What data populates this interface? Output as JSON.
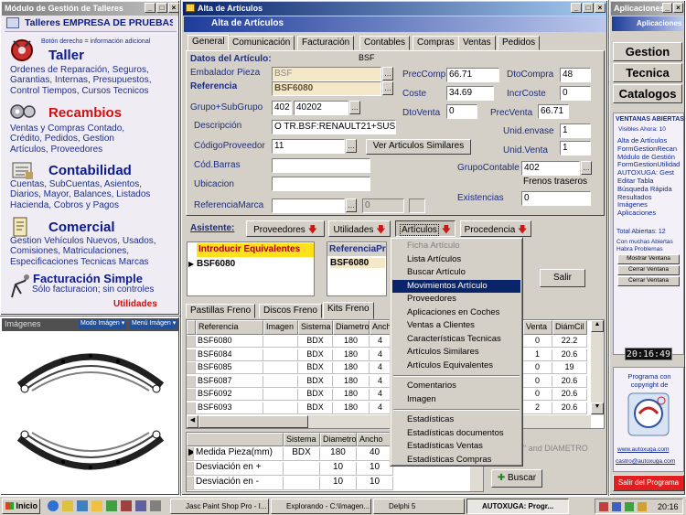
{
  "left_window": {
    "title": "Módulo de Gestión de Talleres",
    "company": "Talleres EMPRESA DE PRUEBAS",
    "hint": "Botón derecho = información adicional",
    "sections": [
      {
        "title": "Taller",
        "lines": [
          "Ordenes de Reparación, Seguros,",
          "Garantias, Internas, Presupuestos,",
          "Control Tiempos, Cursos Tecnicos"
        ]
      },
      {
        "title": "Recambios",
        "lines": [
          "Ventas y Compras Contado,",
          "Crédito, Pedidos,  Gestion",
          "Artículos, Proveedores"
        ]
      },
      {
        "title": "Contabilidad",
        "lines": [
          "Cuentas, SubCuentas, Asientos,",
          "Diarios, Mayor, Balances, Listados",
          "Hacienda, Cobros y Pagos"
        ]
      },
      {
        "title": "Comercial",
        "lines": [
          "Gestion Vehículos Nuevos, Usados,",
          "Comisiones, Matriculaciones,",
          "Especificaciones Tecnicas Marcas"
        ]
      },
      {
        "title": "Facturación Simple",
        "lines": [
          "Sólo facturacion; sin controles"
        ]
      }
    ],
    "utilidades": "Utilidades",
    "colors": {
      "title": "#0b1a8e",
      "recambios": "#d21010",
      "utilidades": "#d21010"
    }
  },
  "images_panel": {
    "title": "Imágenes",
    "mode_label": "Modo Imágen",
    "menu_label": "Menú Imágen"
  },
  "main_window": {
    "title": "Alta de Artículos",
    "header": "Alta de Artículos",
    "tabs": [
      "General",
      "Comunicación",
      "Facturación",
      "Contables",
      "Compras",
      "Ventas",
      "Pedidos"
    ],
    "fields": {
      "datos_label": "Datos del Artículo:",
      "datos_value": "BSF",
      "embalador_label": "Embalador Pieza",
      "embalador_value": "BSF",
      "referencia_label": "Referencia",
      "referencia_value": "BSF6080",
      "grupo_label": "Grupo+SubGrupo",
      "grupo_value": "402",
      "subgrupo_value": "40202",
      "descripcion_label": "Descripción",
      "descripcion_value": "O TR.BSF:RENAULT21+SUS",
      "codprov_label": "CódigoProveedor",
      "codprov_value": "11",
      "similares_button": "Ver Articulos Similares",
      "codbarras_label": "Cód.Barras",
      "ubicacion_label": "Ubicacion",
      "refmarca_label": "ReferenciaMarca",
      "refmarca_num": "0",
      "preccomp_label": "PrecComp",
      "preccomp_value": "66.71",
      "dtocompra_label": "DtoCompra",
      "dtocompra_value": "48",
      "coste_label": "Coste",
      "coste_value": "34.69",
      "incrcoste_label": "IncrCoste",
      "incrcoste_value": "0",
      "dtoventa_label": "DtoVenta",
      "dtoventa_value": "0",
      "precventa_label": "PrecVenta",
      "precventa_value": "66.71",
      "unienvase_label": "Unid.envase",
      "unienvase_value": "1",
      "univenta_label": "Unid.Venta",
      "univenta_value": "1",
      "grupocontable_label": "GrupoContable",
      "grupocontable_value": "402",
      "grupocontable_desc": "Frenos traseros",
      "existencias_label": "Existencias",
      "existencias_value": "0"
    },
    "asistente": {
      "label": "Asistente:",
      "buttons": [
        "Proveedores",
        "Utilidades",
        "Artículos",
        "Procedencia"
      ]
    },
    "equivalentes": {
      "header": "Introducir Equivalentes",
      "value": "BSF6080",
      "ref_header": "ReferenciaPr",
      "ref_value": "BSF6080",
      "salir": "Salir"
    },
    "lower_tabs": [
      "Pastillas Freno",
      "Discos Freno",
      "Kits Freno"
    ],
    "table": {
      "columns": [
        "Referencia",
        "Imagen",
        "Sistema",
        "Diametro",
        "Ancho"
      ],
      "right_columns": [
        "Venta",
        "DiámCil"
      ],
      "rows": [
        {
          "ref": "BSF6080",
          "sis": "BDX",
          "dia": "180",
          "an": "4",
          "v": "0",
          "dc": "22.2"
        },
        {
          "ref": "BSF6084",
          "sis": "BDX",
          "dia": "180",
          "an": "4",
          "v": "1",
          "dc": "20.6"
        },
        {
          "ref": "BSF6085",
          "sis": "BDX",
          "dia": "180",
          "an": "4",
          "v": "0",
          "dc": "19"
        },
        {
          "ref": "BSF6087",
          "sis": "BDX",
          "dia": "180",
          "an": "4",
          "v": "0",
          "dc": "20.6"
        },
        {
          "ref": "BSF6092",
          "sis": "BDX",
          "dia": "180",
          "an": "4",
          "v": "0",
          "dc": "20.6"
        },
        {
          "ref": "BSF6093",
          "sis": "BDX",
          "dia": "180",
          "an": "4",
          "v": "2",
          "dc": "20.6"
        }
      ]
    },
    "medida": {
      "columns": [
        "Sistema",
        "Diametro",
        "Ancho"
      ],
      "rows": [
        {
          "label": "Medida Pieza(mm)",
          "sis": "BDX",
          "dia": "180",
          "an": "40"
        },
        {
          "label": "Desviación en +",
          "sis": "",
          "dia": "10",
          "an": "10"
        },
        {
          "label": "Desviación en -",
          "sis": "",
          "dia": "10",
          "an": "10"
        }
      ],
      "hint": "X\" and DIAMETRO",
      "buscar": "Buscar"
    },
    "dropdown": {
      "items": [
        "Ficha Artículo",
        "Lista Artículos",
        "Buscar Artículo",
        "Movimientos Artículo",
        "Proveedores",
        "Aplicaciones en Coches",
        "Ventas a Clientes",
        "Características Tecnicas",
        "Artículos Similares",
        "Artículos Equivalentes",
        "Comentarios",
        "Imagen",
        "Estadísticas",
        "Estadísticas documentos",
        "Estadísticas Ventas",
        "Estadísticas Compras"
      ],
      "selected": "Movimientos Artículo",
      "disabled": "Ficha Artículo"
    }
  },
  "right_window": {
    "title": "Aplicaciones",
    "header": "Aplicaciones",
    "buttons": [
      "Gestion",
      "Tecnica",
      "Catalogos"
    ],
    "ventanas_title": "VENTANAS ABIERTAS",
    "visibles": "Visibles Ahora: 10",
    "links": [
      "Alta de Artículos",
      "FormGestionRecan",
      "Módulo de Gestión",
      "FormGestionUtilidad",
      "AUTOXUGA:  Gest",
      "Editar Tabla",
      "Búsqueda Rápida",
      "Resultados",
      "Imágenes",
      "Aplicaciones"
    ],
    "total": "Total Abiertas: 12",
    "problemas": "Con muchas Abiertas Habra Problemas",
    "small_buttons": [
      "Mostrar Ventana",
      "Cerrar Ventana",
      "Cerrar Ventana"
    ],
    "clock": "20:16:49",
    "copyright": "Programa con copyright de",
    "url1": "www.autoxuga.com",
    "url2": "castro@autoxuga.com",
    "salir": "Salir del Programa"
  },
  "taskbar": {
    "start": "Inicio",
    "tasks": [
      "Jasc Paint Shop Pro - I...",
      "Explorando - C:\\Imagen...",
      "Delphi 5",
      "AUTOXUGA: Progr..."
    ],
    "time": "20:16"
  }
}
